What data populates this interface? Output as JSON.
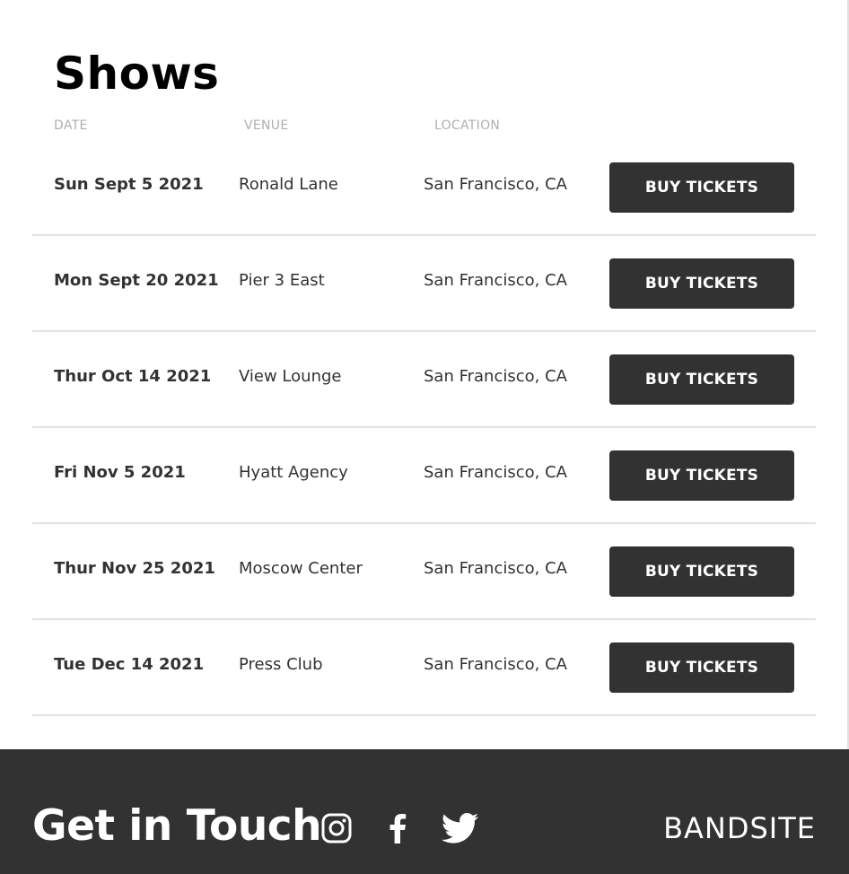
{
  "shows": {
    "title": "Shows",
    "headers": {
      "date": "DATE",
      "venue": "VENUE",
      "location": "LOCATION"
    },
    "rows": [
      {
        "date": "Sun Sept 5 2021",
        "venue": "Ronald Lane",
        "location": "San Francisco, CA",
        "button": "BUY TICKETS"
      },
      {
        "date": "Mon Sept 20 2021",
        "venue": "Pier 3 East",
        "location": "San Francisco, CA",
        "button": "BUY TICKETS"
      },
      {
        "date": "Thur Oct 14 2021",
        "venue": "View Lounge",
        "location": "San Francisco, CA",
        "button": "BUY TICKETS"
      },
      {
        "date": "Fri Nov 5 2021",
        "venue": "Hyatt Agency",
        "location": "San Francisco, CA",
        "button": "BUY TICKETS"
      },
      {
        "date": "Thur Nov 25 2021",
        "venue": "Moscow Center",
        "location": "San Francisco, CA",
        "button": "BUY TICKETS"
      },
      {
        "date": "Tue Dec 14 2021",
        "venue": "Press Club",
        "location": "San Francisco, CA",
        "button": "BUY TICKETS"
      }
    ]
  },
  "footer": {
    "title": "Get in Touch",
    "brand": "BANDSITE",
    "social_icons": [
      "instagram-icon",
      "facebook-icon",
      "twitter-icon"
    ]
  },
  "colors": {
    "dark": "#323232",
    "divider": "#e1e1e1",
    "header_text": "#afafaf",
    "white": "#ffffff"
  }
}
